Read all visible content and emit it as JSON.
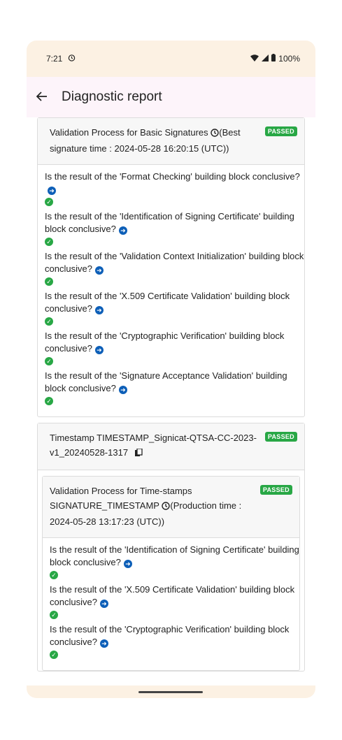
{
  "status_bar": {
    "time": "7:21",
    "battery": "100%"
  },
  "app_bar": {
    "title": "Diagnostic report"
  },
  "sections": [
    {
      "title": "Validation Process for Basic Signatures",
      "title_suffix": "(Best signature time : 2024-05-28 16:20:15 (UTC))",
      "badge": "PASSED",
      "checks": [
        "Is the result of the 'Format Checking' building block conclusive?",
        "Is the result of the 'Identification of Signing Certificate' building block conclusive?",
        "Is the result of the 'Validation Context Initialization' building block conclusive?",
        "Is the result of the 'X.509 Certificate Validation' building block conclusive?",
        "Is the result of the 'Cryptographic Verification' building block conclusive?",
        "Is the result of the 'Signature Acceptance Validation' building block conclusive?"
      ]
    }
  ],
  "timestamp": {
    "title": "Timestamp TIMESTAMP_Signicat-QTSA-CC-2023-v1_20240528-1317",
    "badge": "PASSED",
    "inner": {
      "title": "Validation Process for Time-stamps SIGNATURE_TIMESTAMP",
      "title_suffix": "(Production time : 2024-05-28 13:17:23 (UTC))",
      "badge": "PASSED",
      "checks": [
        "Is the result of the 'Identification of Signing Certificate' building block conclusive?",
        "Is the result of the 'X.509 Certificate Validation' building block conclusive?",
        "Is the result of the 'Cryptographic Verification' building block conclusive?"
      ]
    }
  },
  "icons": {
    "back": "arrow-left-icon",
    "clock": "clock-icon",
    "info": "arrow-circle-right-icon",
    "ok": "check-circle-icon",
    "copy": "copy-icon",
    "wifi": "wifi-icon",
    "signal": "signal-icon",
    "battery": "battery-icon"
  },
  "colors": {
    "passed": "#28a745",
    "info": "#0d5fb8",
    "status_bar": "#fcf1e3",
    "app_bar": "#fdf4fa"
  }
}
